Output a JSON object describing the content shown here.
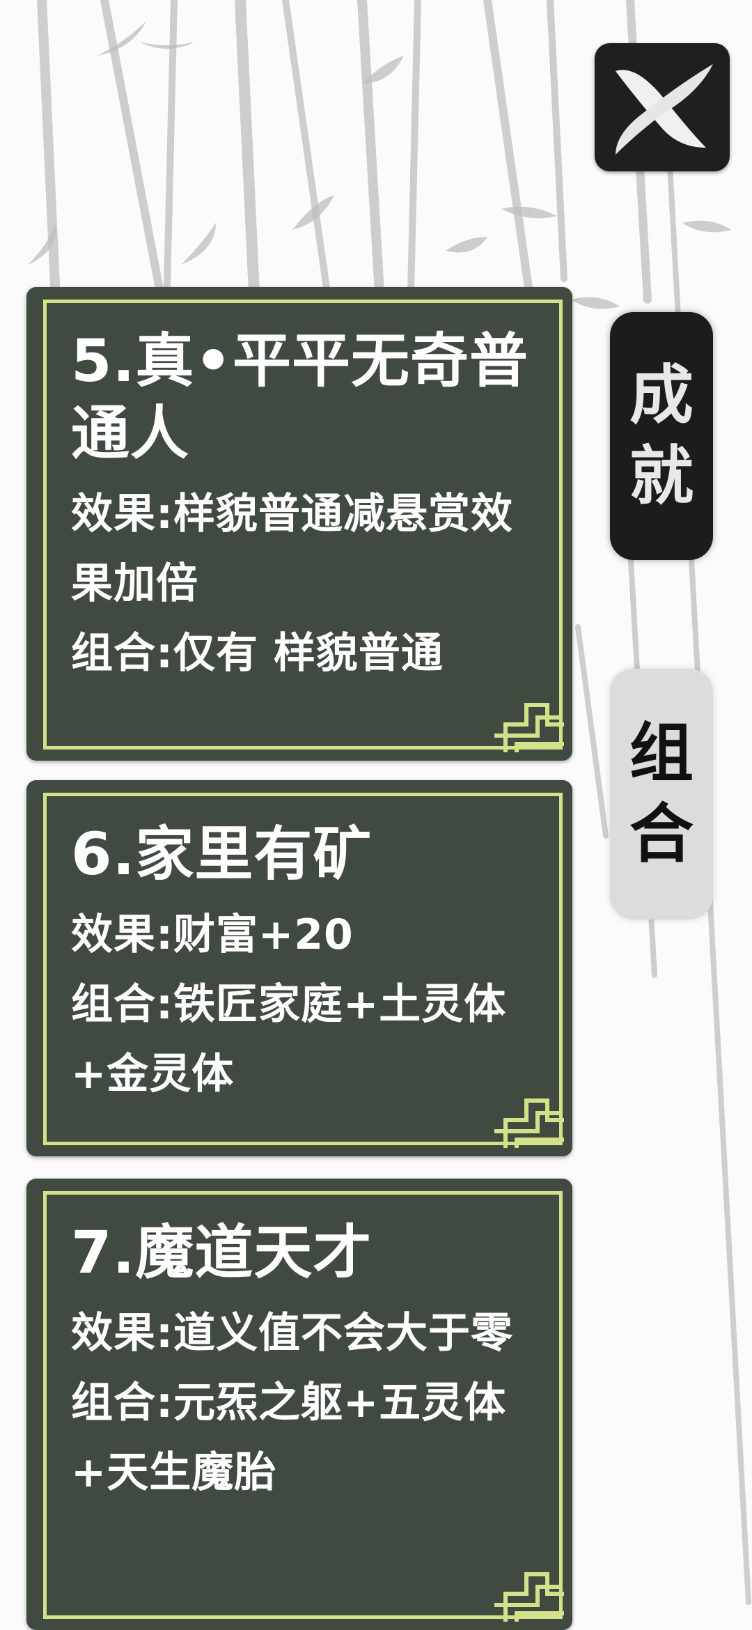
{
  "close": {
    "icon": "close-x-icon"
  },
  "tabs": {
    "achievement": {
      "char1": "成",
      "char2": "就"
    },
    "combo": {
      "char1": "组",
      "char2": "合"
    }
  },
  "cards": [
    {
      "title": "5.真•平平无奇普通人",
      "lines": [
        "效果:样貌普通减悬赏效果加倍",
        "组合:仅有 样貌普通"
      ]
    },
    {
      "title": "6.家里有矿",
      "lines": [
        "效果:财富+20",
        "组合:铁匠家庭+土灵体+金灵体"
      ]
    },
    {
      "title": "7.魔道天才",
      "lines": [
        "效果:道义值不会大于零",
        "组合:元炁之躯+五灵体+天生魔胎"
      ]
    }
  ],
  "colors": {
    "card_bg": "#414a40",
    "card_border": "#d3e28a",
    "tab_active_bg": "#1c1c1c",
    "tab_inactive_bg": "#dcdcdc"
  }
}
